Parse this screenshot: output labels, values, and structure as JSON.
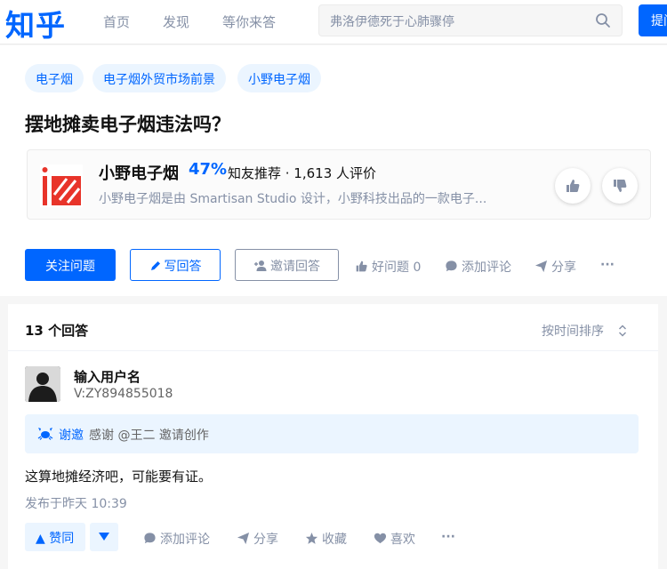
{
  "header": {
    "logo": "知乎",
    "nav": [
      "首页",
      "发现",
      "等你来答"
    ],
    "search_placeholder": "弗洛伊德死于心肺骤停",
    "ask_label": "提问"
  },
  "question": {
    "tags": [
      "电子烟",
      "电子烟外贸市场前景",
      "小野电子烟"
    ],
    "title": "摆地摊卖电子烟违法吗？",
    "product": {
      "name": "小野电子烟",
      "percent": "47%",
      "recommend": "知友推荐 · 1,613 人评价",
      "description": "小野电子烟是由 Smartisan Studio 设计，小野科技出品的一款电子..."
    },
    "actions": {
      "follow": "关注问题",
      "write": "写回答",
      "invite": "邀请回答",
      "good": "好问题 0",
      "comment": "添加评论",
      "share": "分享",
      "more": "···"
    }
  },
  "answers": {
    "count_label": "13 个回答",
    "sort_label": "按时间排序",
    "item": {
      "author": "输入用户名",
      "author_sub": "V:ZY894855018",
      "thanks_label": "谢邀",
      "thanks_text": "感谢 @王二 邀请创作",
      "content": "这算地摊经济吧，可能要有证。",
      "time": "发布于昨天 10:39",
      "actions": {
        "upvote": "▲ 赞同",
        "comment": "添加评论",
        "share": "分享",
        "collect": "收藏",
        "like": "喜欢",
        "more": "···"
      }
    }
  },
  "colors": {
    "brand": "#0066ff",
    "tag_bg": "#ebf5ff",
    "muted": "#8590a6"
  }
}
